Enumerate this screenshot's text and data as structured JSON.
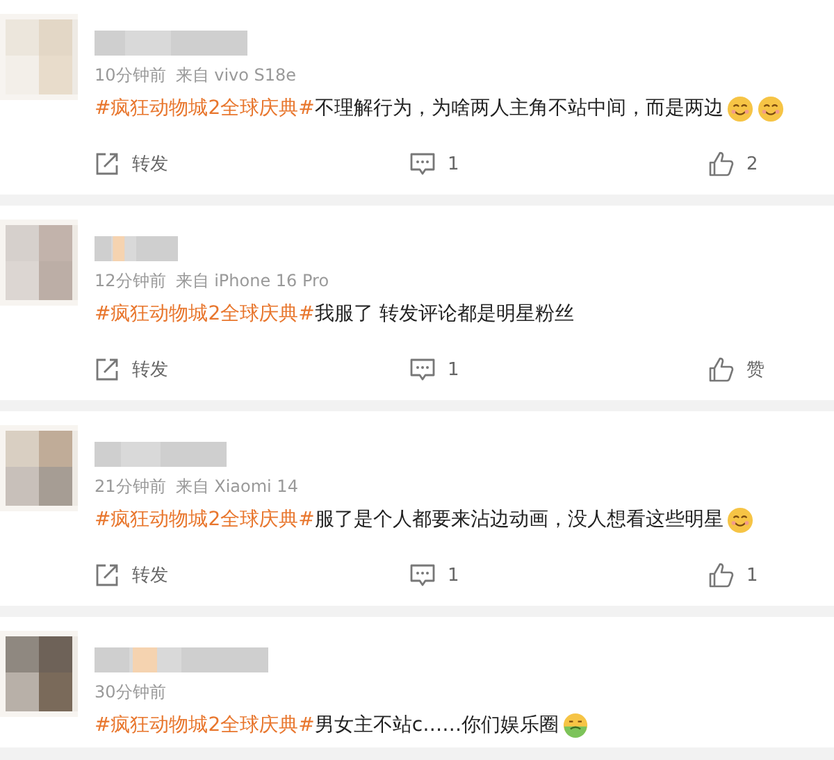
{
  "comments": [
    {
      "time": "10分钟前",
      "source": "来自 vivo S18e",
      "topic": "#疯狂动物城2全球庆典#",
      "text": "不理解行为，为啥两人主角不站中间，而是两边",
      "emojis": [
        {
          "kind": "smile"
        },
        {
          "kind": "smile"
        }
      ],
      "actions": {
        "repost": "转发",
        "comments": "1",
        "likes": "2"
      }
    },
    {
      "time": "12分钟前",
      "source": "来自 iPhone 16 Pro",
      "topic": "#疯狂动物城2全球庆典#",
      "text": "我服了 转发评论都是明星粉丝",
      "actions": {
        "repost": "转发",
        "comments": "1",
        "likes": "赞"
      }
    },
    {
      "time": "21分钟前",
      "source": "来自 Xiaomi 14",
      "topic": "#疯狂动物城2全球庆典#",
      "text": "服了是个人都要来沾边动画，没人想看这些明星",
      "emojis": [
        {
          "kind": "smile"
        }
      ],
      "actions": {
        "repost": "转发",
        "comments": "1",
        "likes": "1"
      }
    },
    {
      "time": "30分钟前",
      "topic": "#疯狂动物城2全球庆典#",
      "text": "男女主不站c……你们娱乐圈",
      "emojis": [
        {
          "kind": "sick"
        }
      ]
    }
  ]
}
